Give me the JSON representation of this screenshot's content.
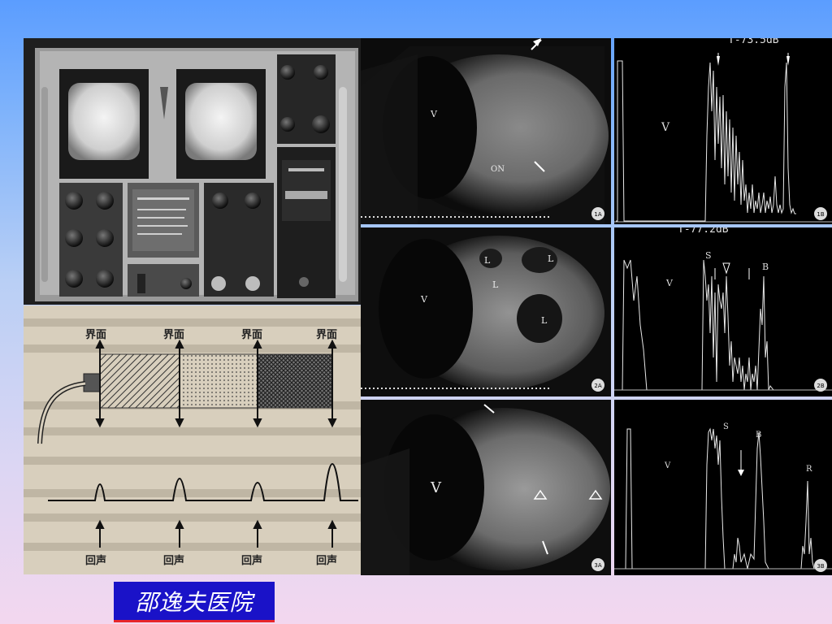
{
  "diagram": {
    "interface_labels": [
      "界面",
      "界面",
      "界面",
      "界面"
    ],
    "echo_labels": [
      "回声",
      "回声",
      "回声",
      "回声"
    ]
  },
  "scans": {
    "s1": {
      "tag": "1A",
      "v": "V",
      "on": "ON"
    },
    "s2": {
      "tag": "2A",
      "v": "V",
      "l1": "L",
      "l2": "L",
      "l3": "L",
      "l4": "L"
    },
    "s3": {
      "tag": "3A",
      "v": "V"
    }
  },
  "ascans": {
    "a1": {
      "tag": "1B",
      "v": "V",
      "header": "T-73.5dB"
    },
    "a2": {
      "tag": "2B",
      "v": "V",
      "header": "T-77.2dB",
      "s": "S",
      "b": "B"
    },
    "a3": {
      "tag": "3B",
      "v": "V",
      "s": "S",
      "b": "B",
      "r": "R"
    }
  },
  "footer": {
    "hospital": "邵逸夫医院"
  },
  "colors": {
    "badge_bg": "#1a12c8",
    "badge_border": "#e8262a"
  }
}
